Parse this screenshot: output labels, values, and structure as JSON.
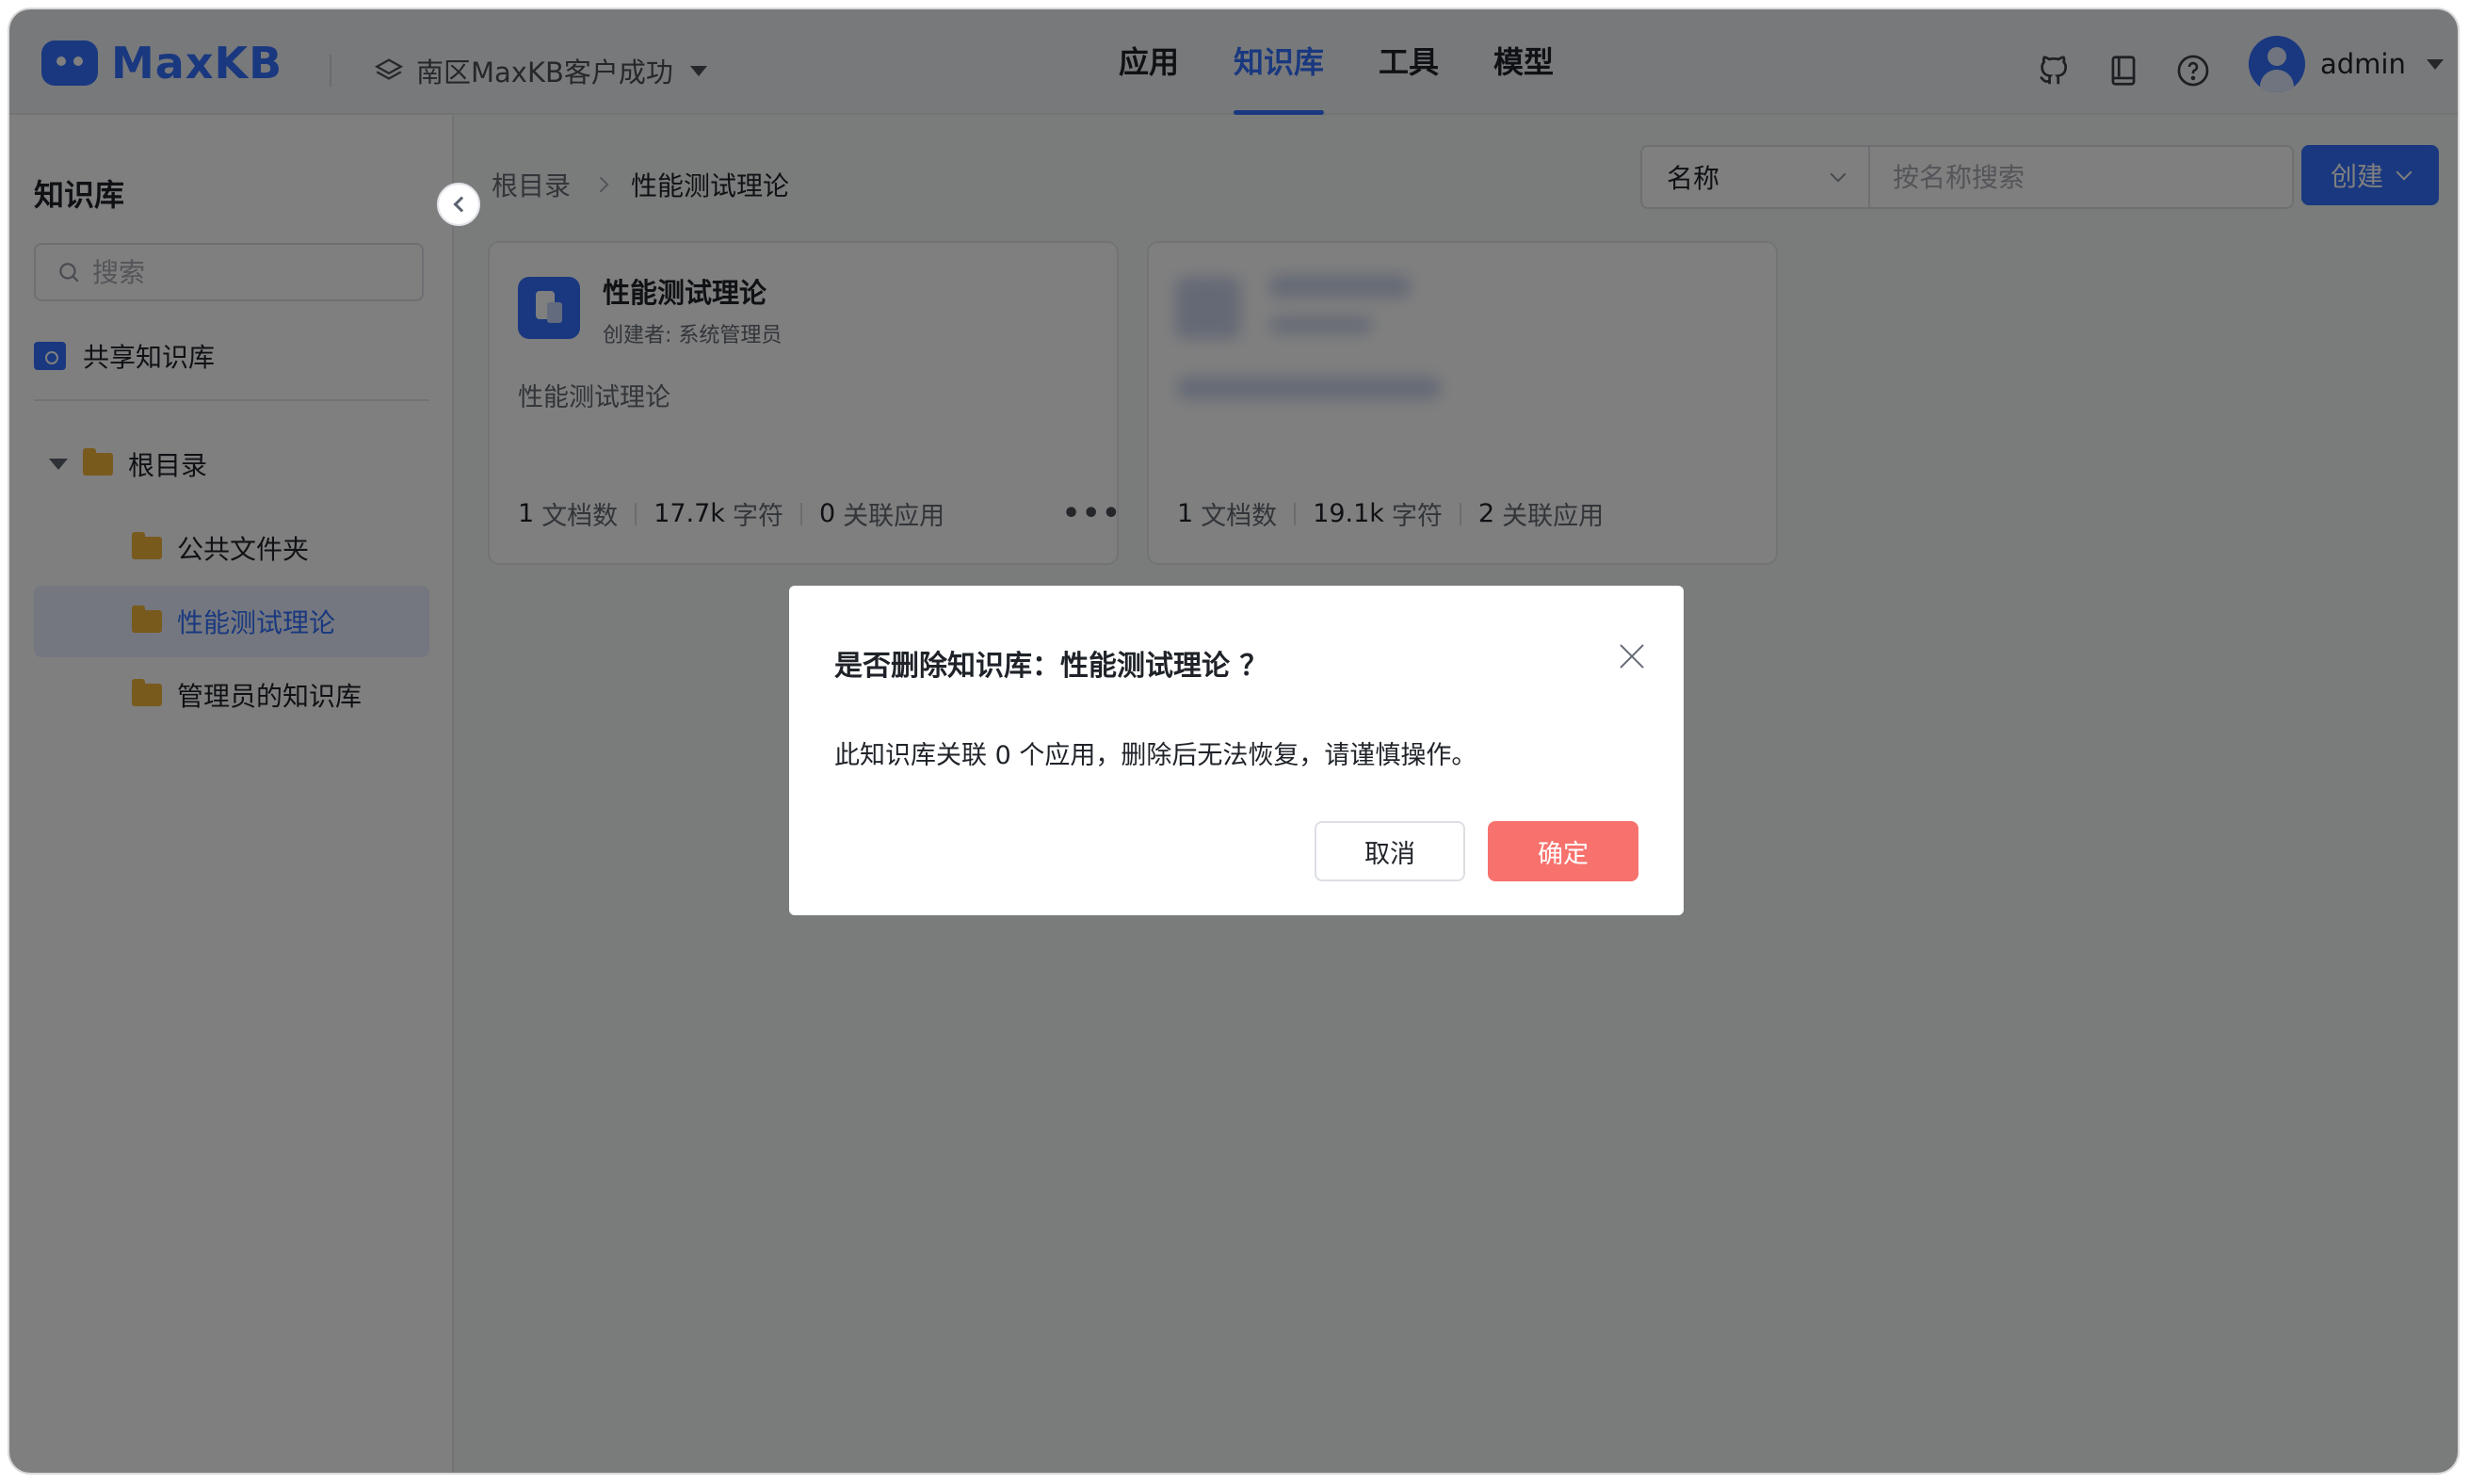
{
  "header": {
    "logo_text": "MaxKB",
    "workspace": "南区MaxKB客户成功",
    "nav": [
      {
        "label": "应用",
        "active": false
      },
      {
        "label": "知识库",
        "active": true
      },
      {
        "label": "工具",
        "active": false
      },
      {
        "label": "模型",
        "active": false
      }
    ],
    "icons": [
      "github-icon",
      "book-icon",
      "help-icon"
    ],
    "user": "admin"
  },
  "sidebar": {
    "title": "知识库",
    "search_placeholder": "搜索",
    "shared": "共享知识库",
    "tree": {
      "root": "根目录",
      "children": [
        {
          "label": "公共文件夹",
          "active": false
        },
        {
          "label": "性能测试理论",
          "active": true
        },
        {
          "label": "管理员的知识库",
          "active": false
        }
      ]
    }
  },
  "main": {
    "breadcrumb": {
      "root": "根目录",
      "current": "性能测试理论"
    },
    "filter": {
      "field": "名称",
      "placeholder": "按名称搜索"
    },
    "create_label": "创建",
    "cards": [
      {
        "title": "性能测试理论",
        "creator": "创建者: 系统管理员",
        "desc": "性能测试理论",
        "docs": "1",
        "docs_label": "文档数",
        "chars": "17.7k",
        "chars_label": "字符",
        "apps": "0",
        "apps_label": "关联应用",
        "more": "•••"
      },
      {
        "docs": "1",
        "docs_label": "文档数",
        "chars": "19.1k",
        "chars_label": "字符",
        "apps": "2",
        "apps_label": "关联应用"
      }
    ]
  },
  "dialog": {
    "title": "是否删除知识库：性能测试理论 ？",
    "body": "此知识库关联 0 个应用，删除后无法恢复，请谨慎操作。",
    "cancel": "取消",
    "confirm": "确定"
  },
  "colors": {
    "accent": "#3370ff",
    "danger": "#f54a45",
    "folder": "#f2b53a"
  }
}
